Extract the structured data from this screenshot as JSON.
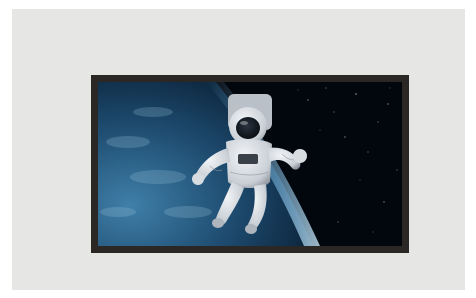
{
  "scene": {
    "background_color": "#e6e6e4",
    "frame_color": "#2b2725",
    "screen": {
      "subject": "astronaut-in-space",
      "space_color": "#02060d",
      "earth_color": "#1d4a6e",
      "atmosphere_color": "#8fd3ff"
    }
  }
}
